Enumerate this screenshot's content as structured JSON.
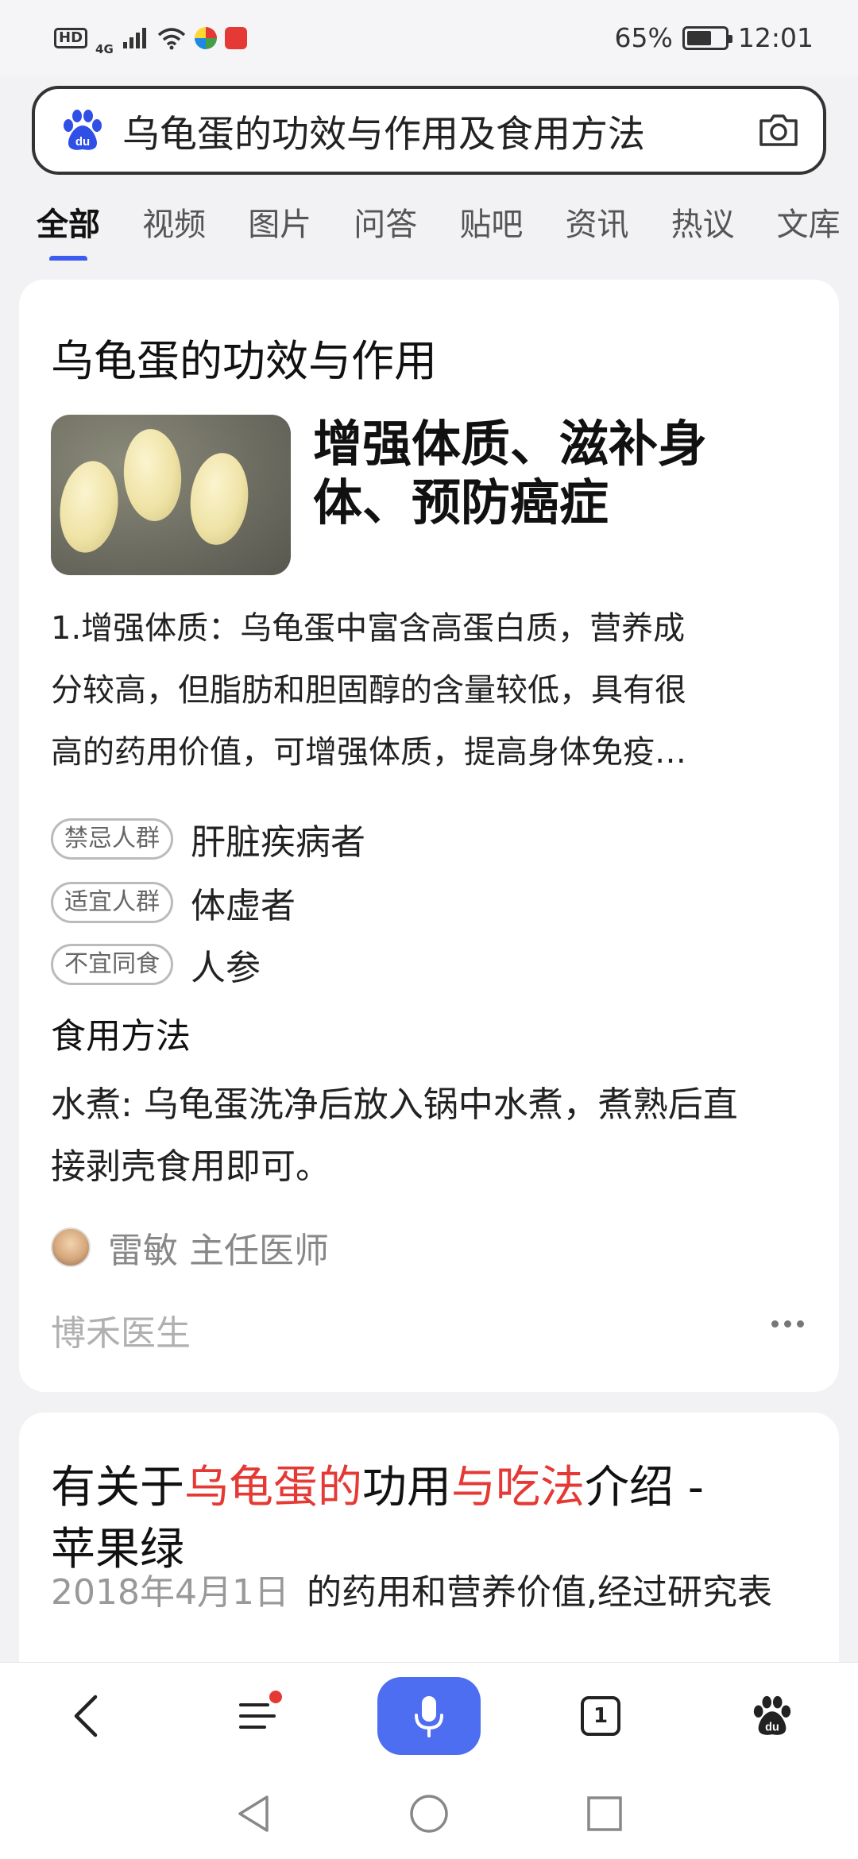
{
  "status_bar": {
    "hd": "HD",
    "signal": "4G",
    "battery_percent": "65%",
    "battery_level": 0.65,
    "time": "12:01"
  },
  "search": {
    "query": "乌龟蛋的功效与作用及食用方法"
  },
  "tabs": [
    "全部",
    "视频",
    "图片",
    "问答",
    "贴吧",
    "资讯",
    "热议",
    "文库"
  ],
  "active_tab": "全部",
  "card1": {
    "title": "乌龟蛋的功效与作用",
    "headline_line1": "增强体质、滋补身",
    "headline_line2": "体、预防癌症",
    "desc_lines": [
      "1.增强体质：乌龟蛋中富含高蛋白质，营养成",
      "分较高，但脂肪和胆固醇的含量较低，具有很",
      "高的药用价值，可增强体质，提高身体免疫…"
    ],
    "tags": [
      {
        "label": "禁忌人群",
        "value": "肝脏疾病者"
      },
      {
        "label": "适宜人群",
        "value": "体虚者"
      },
      {
        "label": "不宜同食",
        "value": "人参"
      }
    ],
    "method_label": "食用方法",
    "method_line1": "水煮: 乌龟蛋洗净后放入锅中水煮，煮熟后直",
    "method_line2": "接剥壳食用即可。",
    "author": "雷敏 主任医师",
    "source": "博禾医生"
  },
  "card2": {
    "title_parts": [
      "有关于",
      "乌龟蛋的",
      "功用",
      "与吃法",
      "介绍 -"
    ],
    "title_line2": "苹果绿",
    "date": "2018年4月1日",
    "snippet": "的药用和营养价值,经过研究表"
  },
  "bottom_nav": {
    "tab_count": "1"
  },
  "colors": {
    "accent": "#3d5af1",
    "mic_button": "#4e6ef2",
    "highlight_red": "#e53935"
  }
}
